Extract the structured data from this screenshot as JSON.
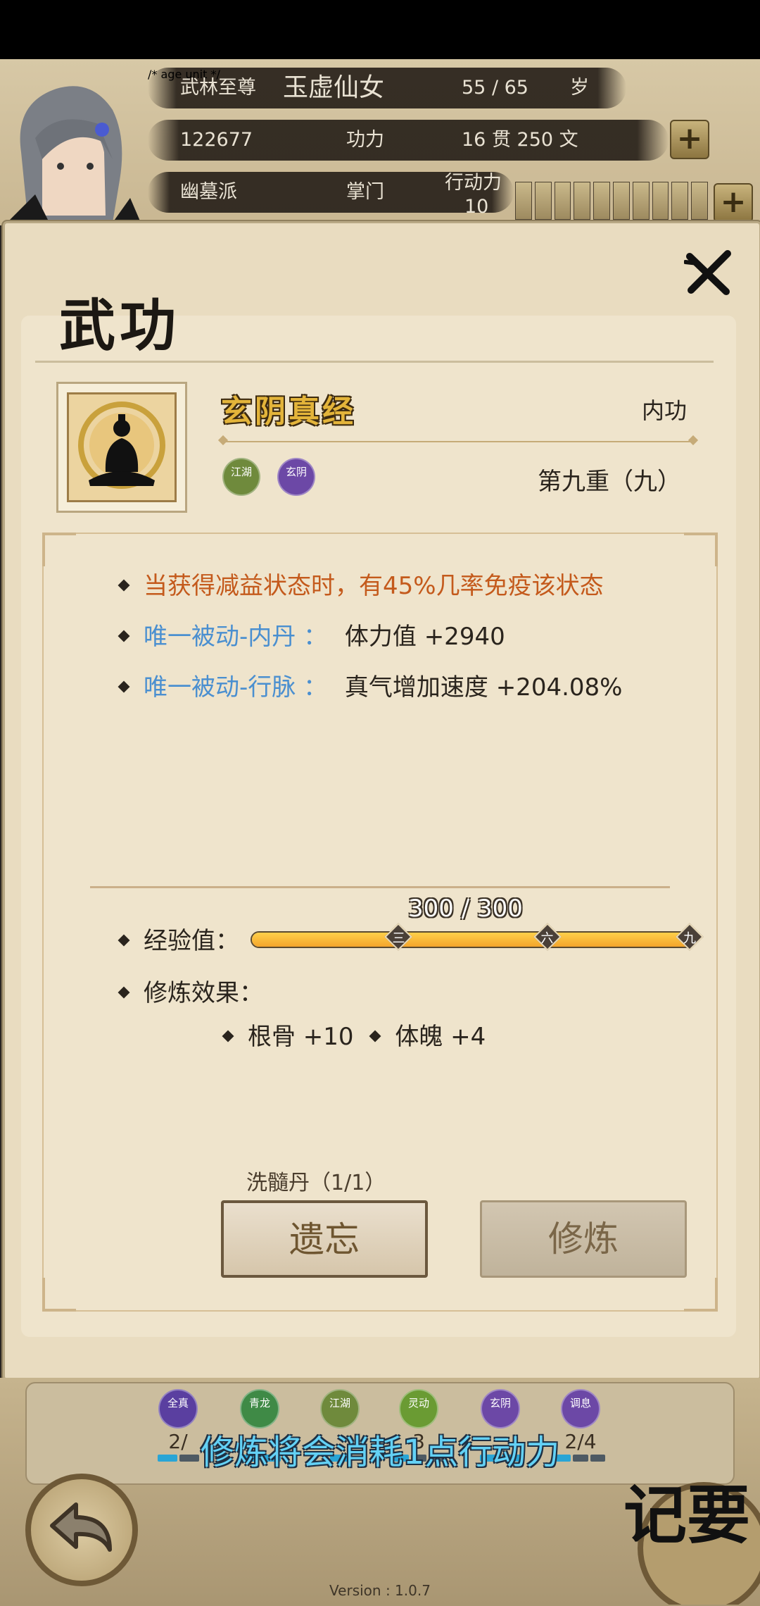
{
  "header": {
    "title_rank": "武林至尊",
    "char_name": "玉虚仙女",
    "age": "55 / 65",
    "age_unit": "岁",
    "power_value": "122677",
    "power_label": "功力",
    "money": "16  贯  250  文",
    "sect": "幽墓派",
    "position": "掌门",
    "energy_label": "行动力",
    "energy_value": "10",
    "energy_segments": 10
  },
  "panel": {
    "title": "武功",
    "skill": {
      "name": "玄阴真经",
      "type": "内功",
      "level": "第九重（九）",
      "badges": [
        {
          "text": "江湖",
          "color": "#6f8a3c"
        },
        {
          "text": "玄阴",
          "color": "#6c48a6"
        }
      ]
    },
    "effects": [
      {
        "label": "当获得减益状态时，有45%几率免疫该状态",
        "value": ""
      },
      {
        "label": "唯一被动-内丹 ：",
        "value": "体力值 +2940"
      },
      {
        "label": "唯一被动-行脉 ：",
        "value": "真气增加速度 +204.08%"
      }
    ],
    "exp": {
      "label": "经验值：",
      "current": 300,
      "max": 300,
      "text": "300 / 300",
      "markers": [
        {
          "label": "三",
          "fraction": 0.333
        },
        {
          "label": "六",
          "fraction": 0.667
        },
        {
          "label": "九",
          "fraction": 1.0
        }
      ]
    },
    "train_effect_label": "修炼效果：",
    "attributes": [
      {
        "text": "根骨 +10"
      },
      {
        "text": "体魄 +4"
      }
    ],
    "marrow_pill": "洗髓丹（1/1）",
    "forget_button": "遗忘",
    "train_button": "修炼"
  },
  "bottom": {
    "schools": [
      {
        "badge": "全真",
        "count": "2/",
        "color": "#5a3fa0",
        "pips": [
          true,
          false
        ]
      },
      {
        "badge": "青龙",
        "count": "",
        "color": "#3f8a46",
        "pips": [
          true,
          true
        ]
      },
      {
        "badge": "江湖",
        "count": "",
        "color": "#6f8a3c",
        "pips": [
          true
        ]
      },
      {
        "badge": "灵动",
        "count": "3",
        "color": "#6a9b33",
        "pips": [
          true,
          false,
          false
        ]
      },
      {
        "badge": "玄阴",
        "count": "",
        "color": "#6c48a6",
        "pips": [
          true,
          true
        ]
      },
      {
        "badge": "调息",
        "count": "2/4",
        "color": "#6c48a6",
        "pips": [
          true,
          false,
          false
        ]
      }
    ],
    "toast": "修炼将会消耗1点行动力",
    "notes_button": "记要",
    "version": "Version : 1.0.7"
  }
}
